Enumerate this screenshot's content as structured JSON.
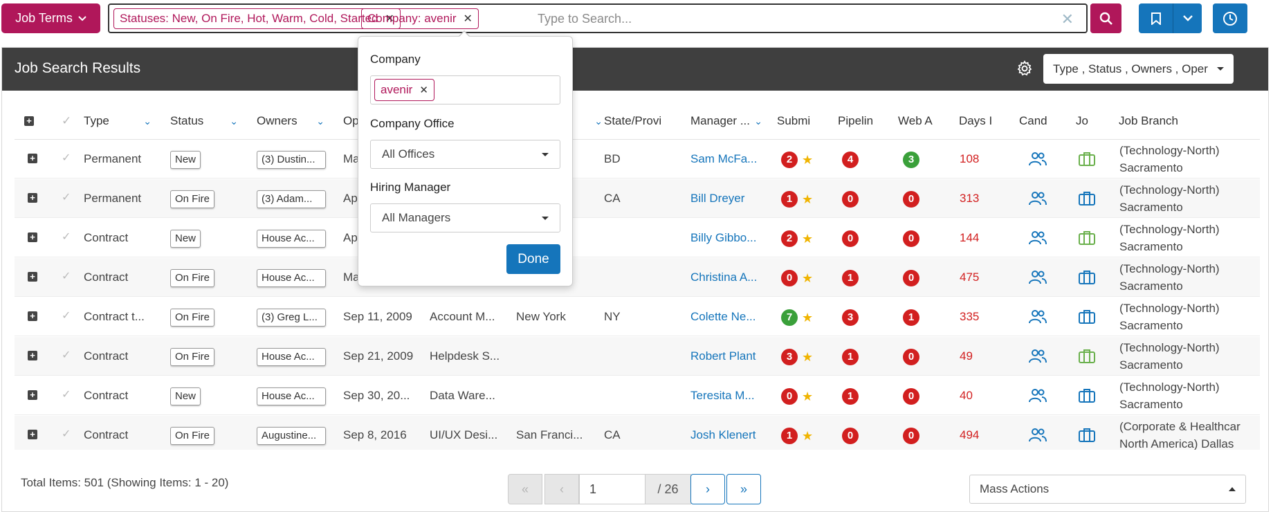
{
  "topbar": {
    "job_terms_label": "Job Terms",
    "tags": [
      {
        "label": "Statuses: New, On Fire, Hot, Warm, Cold, Started"
      },
      {
        "label": "Company: avenir"
      }
    ],
    "search_placeholder": "Type to Search...",
    "accent_color": "#b0175a",
    "primary_color": "#1575bb"
  },
  "panel": {
    "title": "Job Search Results",
    "columns_dropdown": "Type , Status , Owners , Oper"
  },
  "table": {
    "headers": [
      "Type",
      "Status",
      "Owners",
      "Op",
      "",
      "",
      "State/Provi",
      "Manager ...",
      "Submi",
      "Pipelin",
      "Web A",
      "Days I",
      "Cand",
      "Jo",
      "Job Branch"
    ],
    "rows": [
      {
        "type": "Permanent",
        "status": "New",
        "owners": "(3) Dustin...",
        "opened": "Ma",
        "title": "",
        "city": "",
        "state": "BD",
        "manager": "Sam McFa...",
        "submitted": "2",
        "pipeline": "4",
        "web": "3",
        "days": "108",
        "branch_1": "(Technology-North)",
        "branch_2": "Sacramento"
      },
      {
        "type": "Permanent",
        "status": "On Fire",
        "owners": "(3) Adam...",
        "opened": "Ap",
        "title": "",
        "city": "",
        "state": "CA",
        "manager": "Bill Dreyer",
        "submitted": "1",
        "pipeline": "0",
        "web": "0",
        "days": "313",
        "branch_1": "(Technology-North)",
        "branch_2": "Sacramento"
      },
      {
        "type": "Contract",
        "status": "New",
        "owners": "House Ac...",
        "opened": "Ap",
        "title": "",
        "city": "",
        "state": "",
        "manager": "Billy Gibbo...",
        "submitted": "2",
        "pipeline": "0",
        "web": "0",
        "days": "144",
        "branch_1": "(Technology-North)",
        "branch_2": "Sacramento"
      },
      {
        "type": "Contract",
        "status": "On Fire",
        "owners": "House Ac...",
        "opened": "Ma",
        "title": "",
        "city": "",
        "state": "",
        "manager": "Christina A...",
        "submitted": "0",
        "pipeline": "1",
        "web": "0",
        "days": "475",
        "branch_1": "(Technology-North)",
        "branch_2": "Sacramento"
      },
      {
        "type": "Contract t...",
        "status": "On Fire",
        "owners": "(3) Greg L...",
        "opened": "Sep 11, 2009",
        "title": "Account M...",
        "city": "New York",
        "state": "NY",
        "manager": "Colette Ne...",
        "submitted": "7",
        "pipeline": "3",
        "web": "1",
        "days": "335",
        "branch_1": "(Technology-North)",
        "branch_2": "Sacramento"
      },
      {
        "type": "Contract",
        "status": "On Fire",
        "owners": "House Ac...",
        "opened": "Sep 21, 2009",
        "title": "Helpdesk S...",
        "city": "",
        "state": "",
        "manager": "Robert Plant",
        "submitted": "3",
        "pipeline": "1",
        "web": "0",
        "days": "49",
        "branch_1": "(Technology-North)",
        "branch_2": "Sacramento"
      },
      {
        "type": "Contract",
        "status": "New",
        "owners": "House Ac...",
        "opened": "Sep 30, 20...",
        "title": "Data Ware...",
        "city": "",
        "state": "",
        "manager": "Teresita M...",
        "submitted": "0",
        "pipeline": "1",
        "web": "0",
        "days": "40",
        "branch_1": "(Technology-North)",
        "branch_2": "Sacramento"
      },
      {
        "type": "Contract",
        "status": "On Fire",
        "owners": "Augustine...",
        "opened": "Sep 8, 2016",
        "title": "UI/UX Desi...",
        "city": "San Franci...",
        "state": "CA",
        "manager": "Josh Klenert",
        "submitted": "1",
        "pipeline": "0",
        "web": "0",
        "days": "494",
        "branch_1": "(Corporate & Healthcar",
        "branch_2": "North America) Dallas"
      }
    ]
  },
  "footer": {
    "total_text": "Total Items: 501 (Showing Items: 1 - 20)",
    "page_value": "1",
    "page_total": "/ 26",
    "mass_actions": "Mass Actions"
  },
  "popover": {
    "company_label": "Company",
    "company_tag": "avenir",
    "office_label": "Company Office",
    "office_value": "All Offices",
    "manager_label": "Hiring Manager",
    "manager_value": "All Managers",
    "done_label": "Done"
  }
}
